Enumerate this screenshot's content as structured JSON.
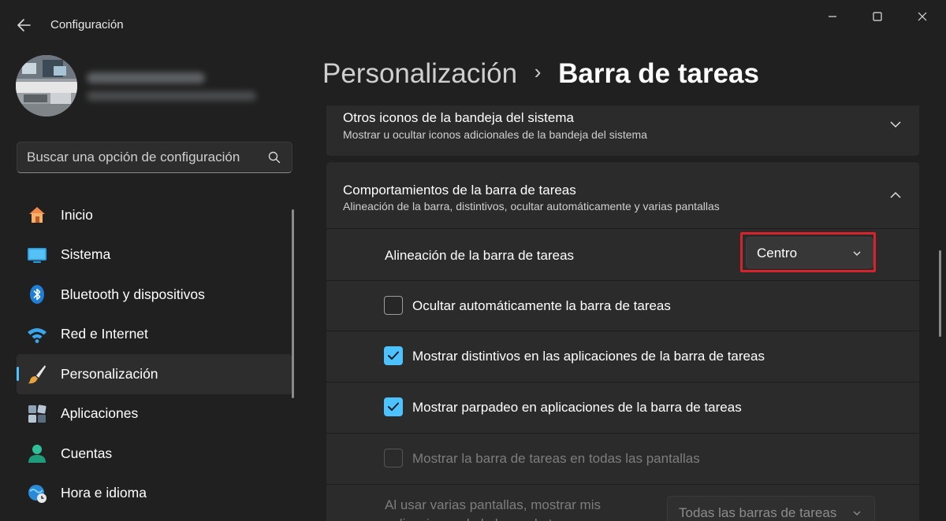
{
  "window": {
    "title": "Configuración",
    "back_icon": "arrow-left-icon",
    "controls": [
      "minimize-icon",
      "maximize-icon",
      "close-icon"
    ]
  },
  "search": {
    "placeholder": "Buscar una opción de configuración",
    "icon": "search-icon"
  },
  "sidebar": {
    "items": [
      {
        "label": "Inicio",
        "icon": "home-icon"
      },
      {
        "label": "Sistema",
        "icon": "display-icon"
      },
      {
        "label": "Bluetooth y dispositivos",
        "icon": "bluetooth-icon"
      },
      {
        "label": "Red e Internet",
        "icon": "wifi-icon"
      },
      {
        "label": "Personalización",
        "icon": "brush-icon",
        "active": true
      },
      {
        "label": "Aplicaciones",
        "icon": "apps-icon"
      },
      {
        "label": "Cuentas",
        "icon": "person-icon"
      },
      {
        "label": "Hora e idioma",
        "icon": "globe-clock-icon"
      }
    ]
  },
  "breadcrumb": {
    "parent": "Personalización",
    "separator": "›",
    "current": "Barra de tareas"
  },
  "sections": {
    "tray": {
      "title": "Otros iconos de la bandeja del sistema",
      "subtitle": "Mostrar u ocultar iconos adicionales de la bandeja del sistema",
      "expanded": false
    },
    "behaviors": {
      "title": "Comportamientos de la barra de tareas",
      "subtitle": "Alineación de la barra, distintivos, ocultar automáticamente y varias pantallas",
      "expanded": true,
      "alignment": {
        "label": "Alineación de la barra de tareas",
        "value": "Centro"
      },
      "options": [
        {
          "label": "Ocultar automáticamente la barra de tareas",
          "checked": false,
          "disabled": false
        },
        {
          "label": "Mostrar distintivos en las aplicaciones de la barra de tareas",
          "checked": true,
          "disabled": false
        },
        {
          "label": "Mostrar parpadeo en aplicaciones de la barra de tareas",
          "checked": true,
          "disabled": false
        },
        {
          "label": "Mostrar la barra de tareas en todas las pantallas",
          "checked": false,
          "disabled": true
        }
      ],
      "multi_display": {
        "label_line1": "Al usar varias pantallas, mostrar mis",
        "label_line2": "aplicaciones de la barra de tareas",
        "value": "Todas las barras de tareas"
      }
    }
  },
  "colors": {
    "accent": "#4cc2ff",
    "highlight": "#d9232b",
    "background": "#202020",
    "card": "#2b2b2b"
  }
}
